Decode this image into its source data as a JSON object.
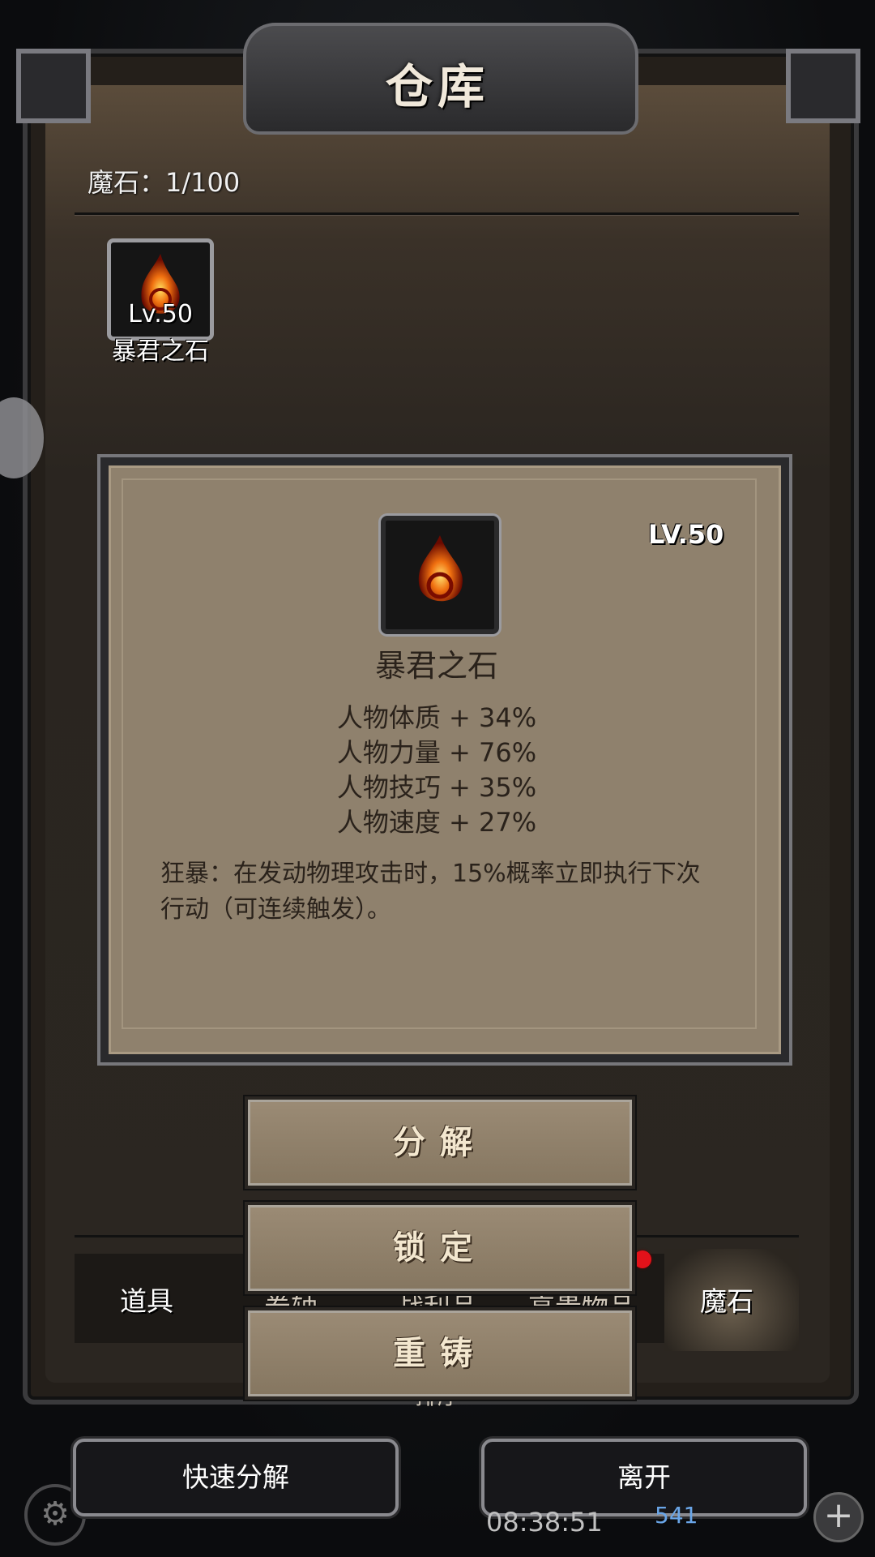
{
  "header": {
    "title": "仓库"
  },
  "inventory": {
    "count_label": "魔石：1/100"
  },
  "item": {
    "level_small": "Lv.50",
    "name": "暴君之石"
  },
  "detail": {
    "level": "LV.50",
    "name": "暴君之石",
    "attributes": [
      "人物体质 + 34%",
      "人物力量 + 76%",
      "人物技巧 + 35%",
      "人物速度 + 27%"
    ],
    "description": "狂暴：在发动物理攻击时，15%概率立即执行下次行动（可连续触发）。"
  },
  "actions": {
    "decompose": "分解",
    "lock": "锁定",
    "reforge": "重铸"
  },
  "tabs": {
    "items": "道具",
    "hidden_1": "卷轴",
    "hidden_2": "战利品",
    "hidden_3": "高贵物品",
    "magic_stone": "魔石",
    "sort": "排序"
  },
  "bottom": {
    "quick_decompose": "快速分解",
    "leave": "离开",
    "time": "08:38:51",
    "currency": "541"
  },
  "colors": {
    "card_bg": "#8f816d",
    "button_text": "#f3e7cf",
    "badge_red": "#e2121a"
  }
}
